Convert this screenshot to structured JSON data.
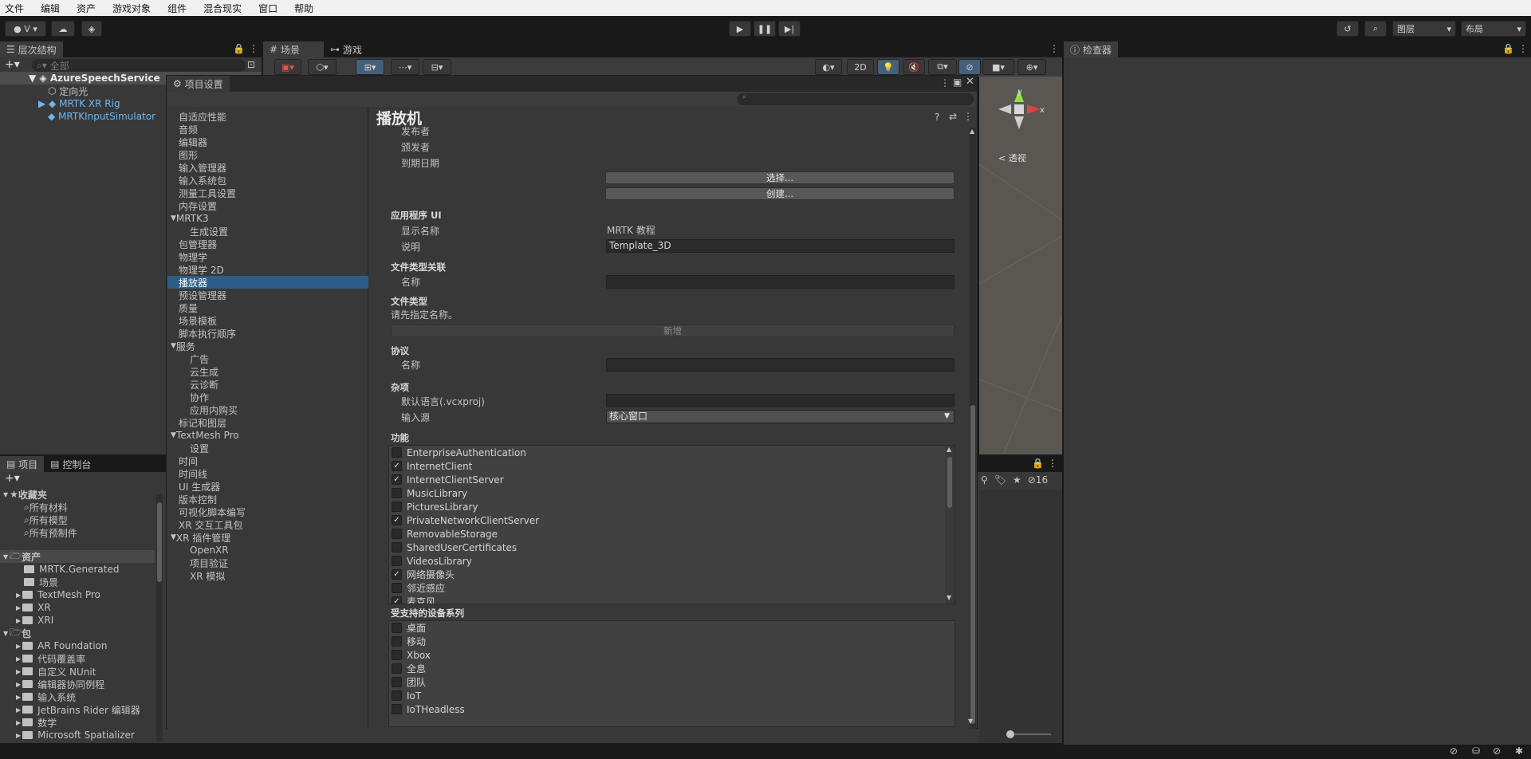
{
  "menu": [
    "文件",
    "编辑",
    "资产",
    "游戏对象",
    "组件",
    "混合现实",
    "窗口",
    "帮助"
  ],
  "toolbar": {
    "account": "V",
    "layers": "图层",
    "layout": "布局"
  },
  "hierarchy": {
    "tab": "层次结构",
    "search_placeholder": "全部",
    "scene": "AzureSpeechService",
    "items": [
      "定向光",
      "MRTK XR Rig",
      "MRTKInputSimulator"
    ]
  },
  "scene_tabs": {
    "scene": "场景",
    "game": "游戏",
    "mode_2d": "2D",
    "persp": "< 透视"
  },
  "inspector": {
    "tab": "检查器"
  },
  "project": {
    "tab_project": "项目",
    "tab_console": "控制台",
    "favorites": "收藏夹",
    "fav_items": [
      "所有材料",
      "所有模型",
      "所有预制件"
    ],
    "assets": "资产",
    "asset_items": [
      "MRTK.Generated",
      "场景",
      "TextMesh Pro",
      "XR",
      "XRI"
    ],
    "packages": "包",
    "package_items": [
      "AR Foundation",
      "代码覆盖率",
      "自定义 NUnit",
      "编辑器协同例程",
      "输入系统",
      "JetBrains Rider 编辑器",
      "数学",
      "Microsoft Spatializer"
    ],
    "hidden_count": "16"
  },
  "settings": {
    "title": "项目设置",
    "nav": [
      "自适应性能",
      "音频",
      "编辑器",
      "图形",
      "输入管理器",
      "输入系统包",
      "测量工具设置",
      "内存设置",
      "MRTK3",
      "生成设置",
      "包管理器",
      "物理学",
      "物理学 2D",
      "播放器",
      "预设管理器",
      "质量",
      "场景模板",
      "脚本执行顺序",
      "服务",
      "广告",
      "云生成",
      "云诊断",
      "协作",
      "应用内购买",
      "标记和图层",
      "TextMesh Pro",
      "设置",
      "时间",
      "时间线",
      "UI 生成器",
      "版本控制",
      "可视化脚本编写",
      "XR 交互工具包",
      "XR 插件管理",
      "OpenXR",
      "项目验证",
      "XR 模拟"
    ],
    "page_title": "播放机",
    "labels": {
      "publisher": "发布者",
      "issuer": "颁发者",
      "expiry": "到期日期",
      "select_btn": "选择...",
      "create_btn": "创建...",
      "app_ui": "应用程序 UI",
      "display_name": "显示名称",
      "display_name_value": "MRTK 教程",
      "description": "说明",
      "description_value": "Template_3D",
      "file_type_assoc": "文件类型关联",
      "name": "名称",
      "file_types": "文件类型",
      "specify_name": "请先指定名称。",
      "add_new": "新增",
      "protocol": "协议",
      "protocol_name": "名称",
      "misc": "杂项",
      "default_lang": "默认语言(.vcxproj)",
      "input_source": "输入源",
      "input_source_value": "核心窗口",
      "capabilities": "功能",
      "device_families": "受支持的设备系列"
    },
    "capabilities": [
      {
        "name": "EnterpriseAuthentication",
        "checked": false
      },
      {
        "name": "InternetClient",
        "checked": true
      },
      {
        "name": "InternetClientServer",
        "checked": true
      },
      {
        "name": "MusicLibrary",
        "checked": false
      },
      {
        "name": "PicturesLibrary",
        "checked": false
      },
      {
        "name": "PrivateNetworkClientServer",
        "checked": true
      },
      {
        "name": "RemovableStorage",
        "checked": false
      },
      {
        "name": "SharedUserCertificates",
        "checked": false
      },
      {
        "name": "VideosLibrary",
        "checked": false
      },
      {
        "name": "网络摄像头",
        "checked": true
      },
      {
        "name": "邻近感应",
        "checked": false
      },
      {
        "name": "麦克风",
        "checked": true
      }
    ],
    "devices": [
      {
        "name": "桌面",
        "checked": false
      },
      {
        "name": "移动",
        "checked": false
      },
      {
        "name": "Xbox",
        "checked": false
      },
      {
        "name": "全息",
        "checked": false
      },
      {
        "name": "团队",
        "checked": false
      },
      {
        "name": "IoT",
        "checked": false
      },
      {
        "name": "IoTHeadless",
        "checked": false
      }
    ]
  }
}
